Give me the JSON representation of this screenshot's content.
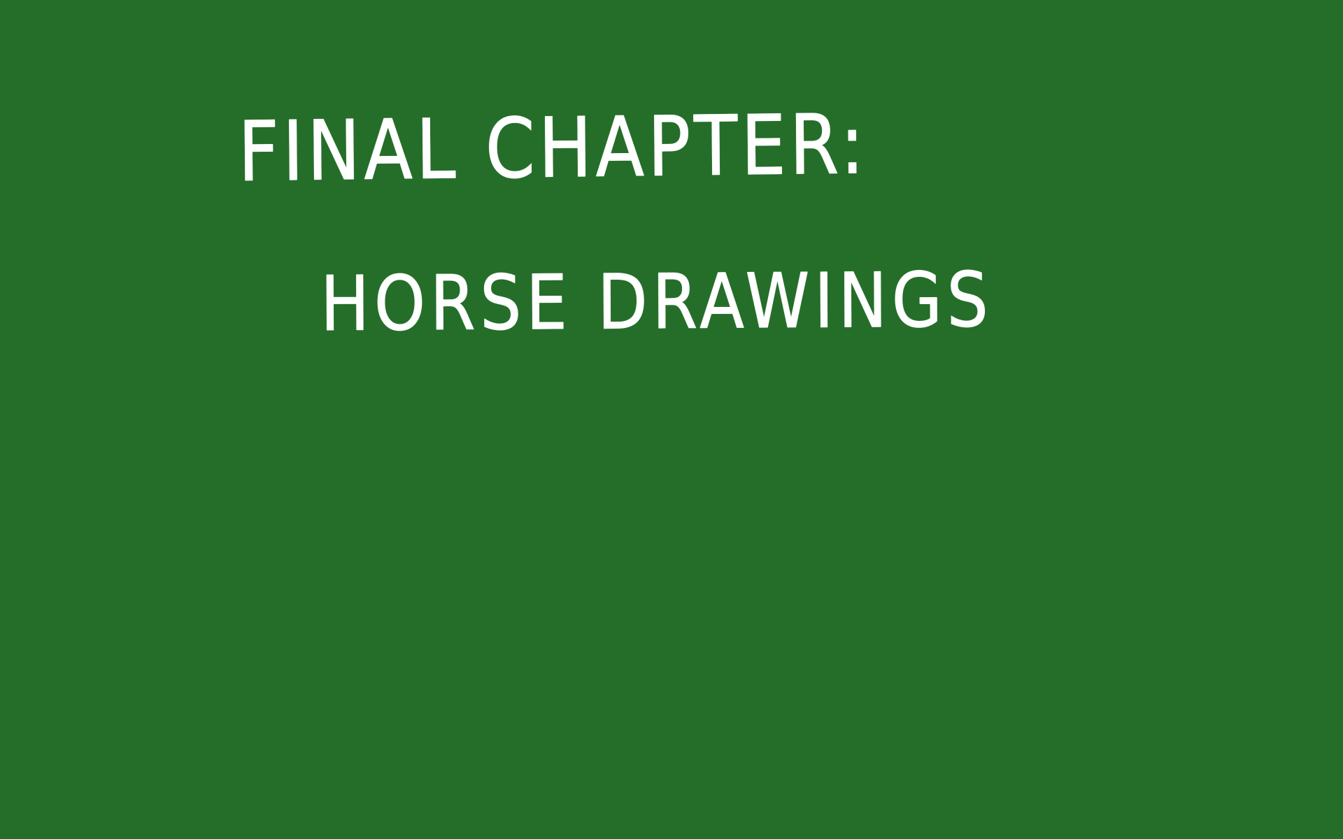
{
  "slide": {
    "background_color": "#246e29",
    "text_color": "#ffffff",
    "title_line_1": "FINAL CHAPTER:",
    "title_line_2": "HORSE DRAWINGS"
  }
}
